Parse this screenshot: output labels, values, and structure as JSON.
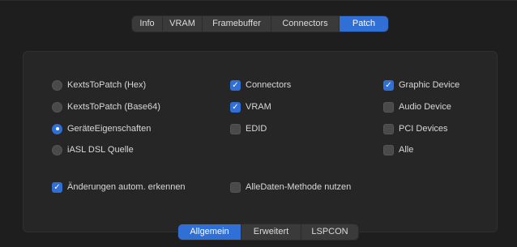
{
  "top_tabs": [
    "Info",
    "VRAM",
    "Framebuffer",
    "Connectors",
    "Patch"
  ],
  "top_tabs_active": "Patch",
  "bottom_tabs": [
    "Allgemein",
    "Erweitert",
    "LSPCON"
  ],
  "bottom_tabs_active": "Allgemein",
  "radios": [
    {
      "label": "KextsToPatch (Hex)",
      "selected": false
    },
    {
      "label": "KextsToPatch (Base64)",
      "selected": false
    },
    {
      "label": "GeräteEigenschaften",
      "selected": true
    },
    {
      "label": "iASL DSL Quelle",
      "selected": false
    }
  ],
  "middle_checks": [
    {
      "label": "Connectors",
      "checked": true
    },
    {
      "label": "VRAM",
      "checked": true
    },
    {
      "label": "EDID",
      "checked": false
    }
  ],
  "right_checks": [
    {
      "label": "Graphic Device",
      "checked": true
    },
    {
      "label": "Audio Device",
      "checked": false
    },
    {
      "label": "PCI Devices",
      "checked": false
    },
    {
      "label": "Alle",
      "checked": false
    }
  ],
  "bottom_checks": [
    {
      "label": "Änderungen autom. erkennen",
      "checked": true
    },
    {
      "label": "AlleDaten-Methode nutzen",
      "checked": false
    }
  ],
  "colors": {
    "accent": "#2f6fd6",
    "background": "#1e1e1e",
    "panel": "#262626"
  }
}
